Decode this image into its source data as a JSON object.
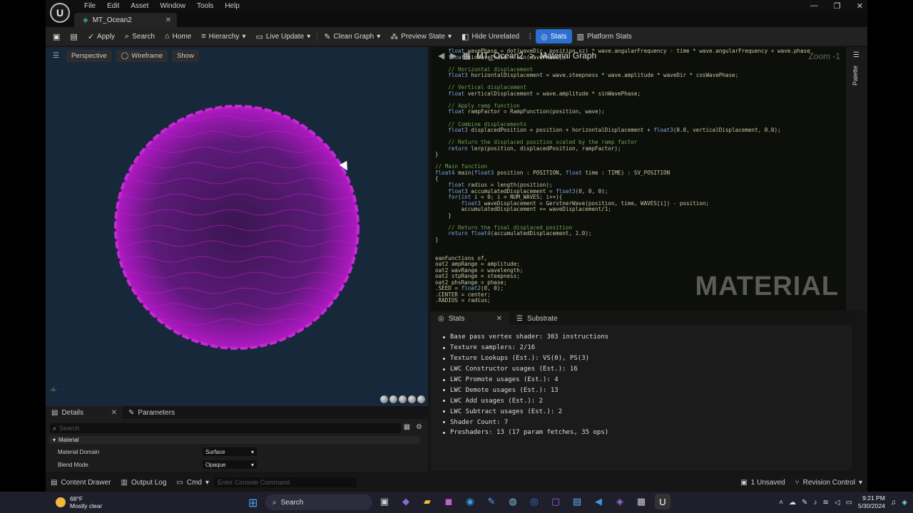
{
  "app": {
    "menu": [
      "File",
      "Edit",
      "Asset",
      "Window",
      "Tools",
      "Help"
    ],
    "window_controls": [
      "—",
      "❐",
      "✕"
    ],
    "doc_tab": "MT_Ocean2"
  },
  "toolbar": {
    "apply": "Apply",
    "search": "Search",
    "home": "Home",
    "hierarchy": "Hierarchy",
    "live_update": "Live Update",
    "clean_graph": "Clean Graph",
    "preview_state": "Preview State",
    "hide_unrelated": "Hide Unrelated",
    "stats": "Stats",
    "platform_stats": "Platform Stats"
  },
  "viewport": {
    "perspective": "Perspective",
    "wireframe": "Wireframe",
    "show": "Show",
    "sphere_color": "#b01ac0"
  },
  "graph": {
    "breadcrumb_asset": "MT_Ocean2",
    "breadcrumb_sep": ">",
    "breadcrumb_view": "Material Graph",
    "zoom": "Zoom -1",
    "watermark": "MATERIAL",
    "palette_label": "Palette"
  },
  "code_lines": [
    "    float wavePhase = dot(waveDir, position.xz) * wave.angularFrequency - time * wave.angularFrequency + wave.phase",
    "    float sinWavePhase = sin(wavePhase);",
    "",
    "    // Horizontal displacement",
    "    float3 horizontalDisplacement = wave.steepness * wave.amplitude * waveDir * cosWavePhase;",
    "",
    "    // Vertical displacement",
    "    float verticalDisplacement = wave.amplitude * sinWavePhase;",
    "",
    "    // Apply ramp function",
    "    float rampFactor = RampFunction(position, wave);",
    "",
    "    // Combine displacements",
    "    float3 displacedPosition = position + horizontalDisplacement + float3(0.0, verticalDisplacement, 0.0);",
    "",
    "    // Return the displaced position scaled by the ramp factor",
    "    return lerp(position, displacedPosition, rampFactor);",
    "}",
    "",
    "// Main function",
    "float4 main(float3 position : POSITION, float time : TIME) : SV_POSITION",
    "{",
    "    float radius = length(position);",
    "    float3 accumulatedDisplacement = float3(0, 0, 0);",
    "    for(int i = 0; i < NUM_WAVES; i++){",
    "        float3 waveDisplacement = GerstnerWave(position, time, WAVES[i]) - position;",
    "        accumulatedDisplacement += waveDisplacement/1;",
    "    }",
    "",
    "    // Return the final displaced position",
    "    return float4(accumulatedDisplacement, 1.0);",
    "}",
    "",
    "",
    "eanFunctions of,",
    "oat2 ampRange = amplitude;",
    "oat2 wavRange = wavelength;",
    "oat2 stpRange = steepness;",
    "oat2 phsRange = phase;",
    ".SEED = float2(0, 0);",
    ".CENTER = center;",
    ".RADIUS = radius;"
  ],
  "stats": {
    "tab_stats": "Stats",
    "tab_substrate": "Substrate",
    "lines": [
      "Base pass vertex shader: 303 instructions",
      "Texture samplers: 2/16",
      "Texture Lookups (Est.): VS(0), PS(3)",
      "LWC Constructor usages (Est.): 16",
      "LWC Promote usages (Est.): 4",
      "LWC Demote usages (Est.): 13",
      "LWC Add usages (Est.): 2",
      "LWC Subtract usages (Est.): 2",
      "Shader Count: 7",
      "Preshaders: 13  (17 param fetches, 35 ops)"
    ]
  },
  "details": {
    "tab_details": "Details",
    "tab_parameters": "Parameters",
    "search_placeholder": "Search",
    "category": "Material",
    "rows": [
      {
        "name": "Material Domain",
        "value": "Surface"
      },
      {
        "name": "Blend Mode",
        "value": "Opaque"
      }
    ]
  },
  "statusbar": {
    "content_drawer": "Content Drawer",
    "output_log": "Output Log",
    "cmd": "Cmd",
    "console_placeholder": "Enter Console Command",
    "unsaved": "1 Unsaved",
    "revision_control": "Revision Control"
  },
  "taskbar": {
    "temp": "68°F",
    "weather": "Mostly clear",
    "search": "Search",
    "time": "9:21 PM",
    "date": "5/30/2024"
  }
}
